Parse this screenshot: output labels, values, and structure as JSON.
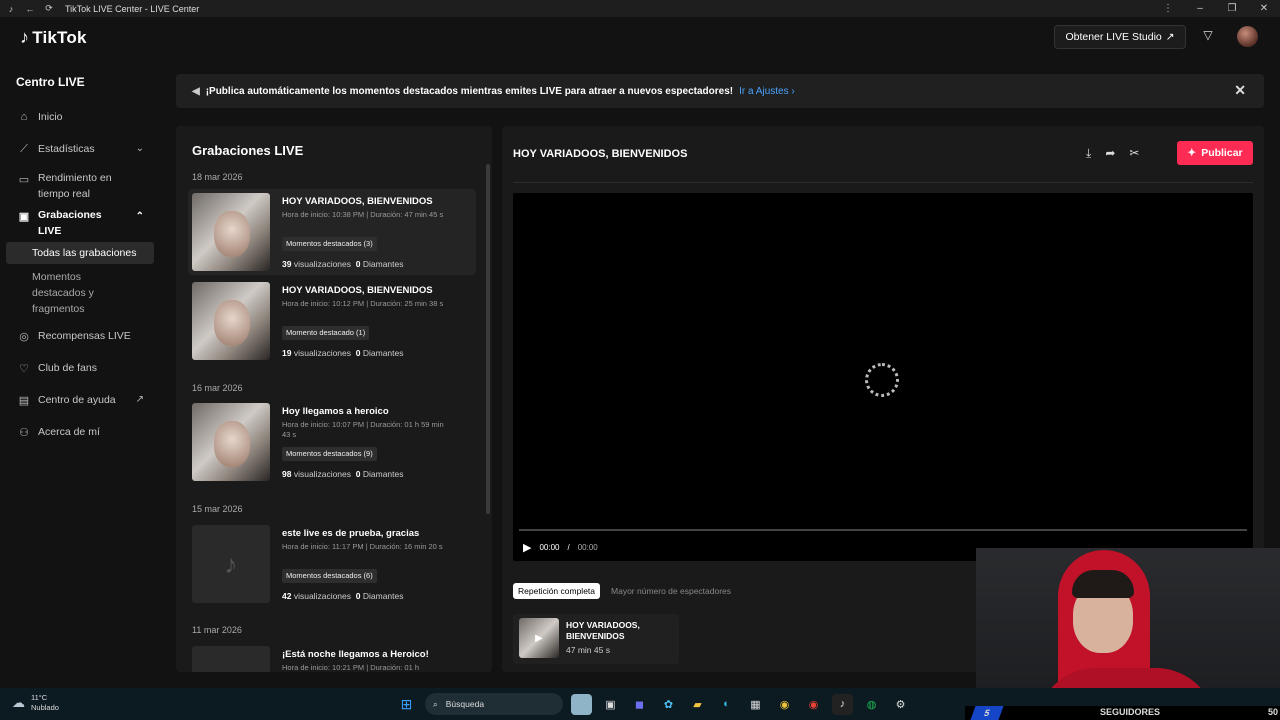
{
  "window": {
    "title": "TikTok LIVE Center - LIVE Center"
  },
  "header": {
    "logo_text": "TikTok",
    "studio_button": "Obtener LIVE Studio"
  },
  "sidebar": {
    "title": "Centro LIVE",
    "items": [
      {
        "label": "Inicio",
        "icon": "home-icon"
      },
      {
        "label": "Estadísticas",
        "icon": "chart-icon"
      },
      {
        "label": "Rendimiento en tiempo real",
        "icon": "monitor-icon"
      },
      {
        "label": "Grabaciones LIVE",
        "icon": "recording-icon"
      },
      {
        "label": "Recompensas LIVE",
        "icon": "reward-icon"
      },
      {
        "label": "Club de fans",
        "icon": "heart-icon"
      },
      {
        "label": "Centro de ayuda",
        "icon": "book-icon"
      },
      {
        "label": "Acerca de mí",
        "icon": "user-icon"
      }
    ],
    "sub_items": [
      {
        "label": "Todas las grabaciones"
      },
      {
        "label": "Momentos destacados y fragmentos"
      }
    ]
  },
  "banner": {
    "text": "¡Publica automáticamente los momentos destacados mientras emites LIVE para atraer a nuevos espectadores!",
    "link": "Ir a Ajustes"
  },
  "recordings": {
    "title": "Grabaciones LIVE",
    "dates": [
      "18 mar 2026",
      "16 mar 2026",
      "15 mar 2026",
      "11 mar 2026"
    ],
    "items": [
      {
        "title": "HOY VARIADOOS, BIENVENIDOS",
        "meta": "Hora de inicio: 10:38 PM | Duración: 47 min 45 s",
        "tag": "Momentos destacados (3)",
        "views": "39",
        "views_label": "visualizaciones",
        "diamonds": "0",
        "diamonds_label": "Diamantes"
      },
      {
        "title": "HOY VARIADOOS, BIENVENIDOS",
        "meta": "Hora de inicio: 10:12 PM | Duración: 25 min 38 s",
        "tag": "Momento destacado (1)",
        "views": "19",
        "views_label": "visualizaciones",
        "diamonds": "0",
        "diamonds_label": "Diamantes"
      },
      {
        "title": "Hoy llegamos a heroico",
        "meta": "Hora de inicio: 10:07 PM | Duración: 01 h 59 min 43 s",
        "tag": "Momentos destacados (9)",
        "views": "98",
        "views_label": "visualizaciones",
        "diamonds": "0",
        "diamonds_label": "Diamantes"
      },
      {
        "title": "este live es de prueba, gracias",
        "meta": "Hora de inicio: 11:17 PM | Duración: 16 min 20 s",
        "tag": "Momentos destacados (6)",
        "views": "42",
        "views_label": "visualizaciones",
        "diamonds": "0",
        "diamonds_label": "Diamantes"
      },
      {
        "title": "¡Está noche llegamos a Heroico!",
        "meta": "Hora de inicio: 10:21 PM | Duración: 01 h"
      }
    ]
  },
  "player": {
    "title": "HOY VARIADOOS, BIENVENIDOS",
    "publish_label": "Publicar",
    "time_current": "00:00",
    "time_sep": "/",
    "time_total": "00:00",
    "tabs": [
      "Repetición completa",
      "Mayor número de espectadores"
    ],
    "clip": {
      "title": "HOY VARIADOOS, BIENVENIDOS",
      "duration": "47 min 45 s"
    }
  },
  "taskbar": {
    "temperature": "11°C",
    "condition": "Nublado",
    "search_placeholder": "Búsqueda"
  },
  "overlay": {
    "count": "5",
    "label": "SEGUIDORES",
    "count2": "50"
  },
  "colors": {
    "accent": "#fe2c55",
    "link": "#4aa3ff",
    "background": "#121212",
    "panel": "#1a1a1a"
  }
}
